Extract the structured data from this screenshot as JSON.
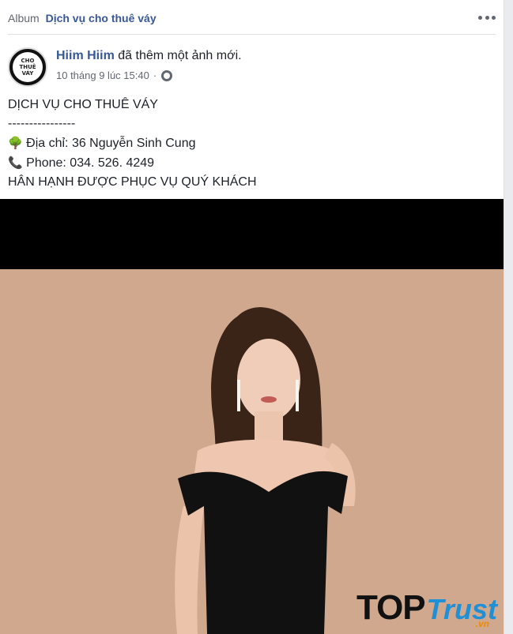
{
  "header": {
    "album_prefix": "Album",
    "album_name": "Dịch vụ cho thuê váy",
    "more_icon": "more-horizontal-icon"
  },
  "post": {
    "avatar_lines": [
      "CHO",
      "THUÊ",
      "VÁY"
    ],
    "author_name": "Hiim Hiim",
    "action_text": "đã thêm một ảnh mới.",
    "timestamp": "10 tháng 9 lúc 15:40",
    "separator": "·",
    "privacy_icon": "globe-icon",
    "body": {
      "title": "DỊCH VỤ CHO THUÊ VÁY",
      "dashes": "----------------",
      "address_icon": "🌳",
      "address": "Địa chỉ: 36 Nguyễn Sinh Cung",
      "phone_icon": "📞",
      "phone": "Phone: 034. 526. 4249",
      "closing": "HÂN HẠNH ĐƯỢC PHỤC VỤ QUÝ KHÁCH"
    }
  },
  "photo": {
    "background_color": "#d0a88e",
    "subject": "woman-black-dress-photo"
  },
  "watermark": {
    "top": "TOP",
    "trust": "Trust",
    "domain": ".vn"
  }
}
